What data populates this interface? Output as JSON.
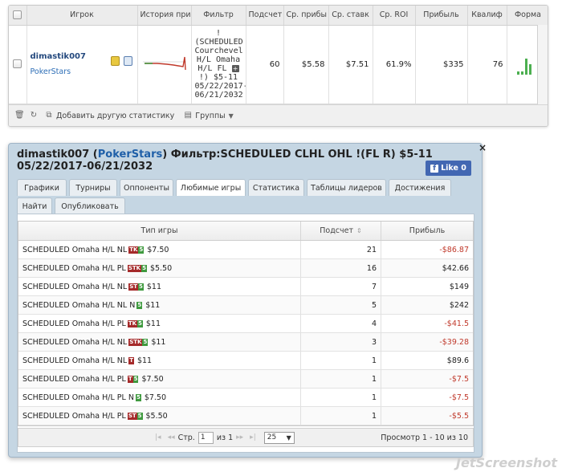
{
  "stats_table": {
    "headers": [
      "",
      "Игрок",
      "История при",
      "Фильтр",
      "Подсчет",
      "Ср. прибы",
      "Ср. ставк",
      "Ср. ROI",
      "Прибыль",
      "Квалиф",
      "Форма"
    ],
    "row": {
      "player_name": "dimastik007",
      "player_room": "PokerStars",
      "filter_lines": [
        "!",
        "(SCHEDULED",
        "Courchevel",
        "H/L Omaha",
        "H/L FL",
        "!) $5-11",
        "05/22/2017-",
        "06/21/2032"
      ],
      "count": "60",
      "avg_profit": "$5.58",
      "avg_stake": "$7.51",
      "avg_roi": "61.9%",
      "profit": "$335",
      "qualif": "76"
    },
    "forma_bars": [
      0.15,
      0.15,
      0.85,
      0.55
    ],
    "history_line_color": "#c0392b"
  },
  "toolbar": {
    "add_stats": "Добавить другую статистику",
    "groups": "Группы"
  },
  "popup": {
    "title_player": "dimastik007",
    "title_room": "PokerStars",
    "title_rest": " Фильтр:SCHEDULED CLHL OHL !(FL R) $5-11",
    "title_dates": "05/22/2017-06/21/2032",
    "close": "×",
    "like_label": "Like 0",
    "tabs": [
      "Графики",
      "Турниры",
      "Оппоненты",
      "Любимые игры",
      "Статистика",
      "Таблицы лидеров",
      "Достижения",
      "Найти",
      "Опубликовать"
    ],
    "active_tab": 3
  },
  "fav_games": {
    "headers": [
      "Тип игры",
      "Подсчет",
      "Прибыль"
    ],
    "rows": [
      {
        "pre": "SCHEDULED Omaha H/L NL",
        "badges": [
          [
            "TK",
            "red"
          ],
          [
            "5",
            "green"
          ]
        ],
        "stake": "$7.50",
        "count": "21",
        "profit": "-$86.87",
        "neg": true
      },
      {
        "pre": "SCHEDULED Omaha H/L PL",
        "badges": [
          [
            "STK",
            "red"
          ],
          [
            "5",
            "green"
          ]
        ],
        "stake": "$5.50",
        "count": "16",
        "profit": "$42.66",
        "neg": false
      },
      {
        "pre": "SCHEDULED Omaha H/L NL",
        "badges": [
          [
            "ST",
            "red"
          ],
          [
            "5",
            "green"
          ]
        ],
        "stake": "$11",
        "count": "7",
        "profit": "$149",
        "neg": false
      },
      {
        "pre": "SCHEDULED Omaha H/L NL N",
        "badges": [
          [
            "5",
            "green"
          ]
        ],
        "stake": "$11",
        "count": "5",
        "profit": "$242",
        "neg": false
      },
      {
        "pre": "SCHEDULED Omaha H/L PL",
        "badges": [
          [
            "TK",
            "red"
          ],
          [
            "5",
            "green"
          ]
        ],
        "stake": "$11",
        "count": "4",
        "profit": "-$41.5",
        "neg": true
      },
      {
        "pre": "SCHEDULED Omaha H/L NL",
        "badges": [
          [
            "STK",
            "red"
          ],
          [
            "5",
            "green"
          ]
        ],
        "stake": "$11",
        "count": "3",
        "profit": "-$39.28",
        "neg": true
      },
      {
        "pre": "SCHEDULED Omaha H/L NL",
        "badges": [
          [
            "T",
            "red"
          ]
        ],
        "stake": "$11",
        "count": "1",
        "profit": "$89.6",
        "neg": false
      },
      {
        "pre": "SCHEDULED Omaha H/L PL",
        "badges": [
          [
            "T",
            "red"
          ],
          [
            "5",
            "green"
          ]
        ],
        "stake": "$7.50",
        "count": "1",
        "profit": "-$7.5",
        "neg": true
      },
      {
        "pre": "SCHEDULED Omaha H/L PL N",
        "badges": [
          [
            "5",
            "green"
          ]
        ],
        "stake": "$7.50",
        "count": "1",
        "profit": "-$7.5",
        "neg": true
      },
      {
        "pre": "SCHEDULED Omaha H/L PL",
        "badges": [
          [
            "ST",
            "red"
          ],
          [
            "5",
            "green"
          ]
        ],
        "stake": "$5.50",
        "count": "1",
        "profit": "-$5.5",
        "neg": true
      }
    ]
  },
  "pager": {
    "page_label": "Стр.",
    "page_value": "1",
    "of_label": "из 1",
    "page_size": "25",
    "summary": "Просмотр 1 - 10 из 10"
  },
  "watermark": "JetScreenshot"
}
